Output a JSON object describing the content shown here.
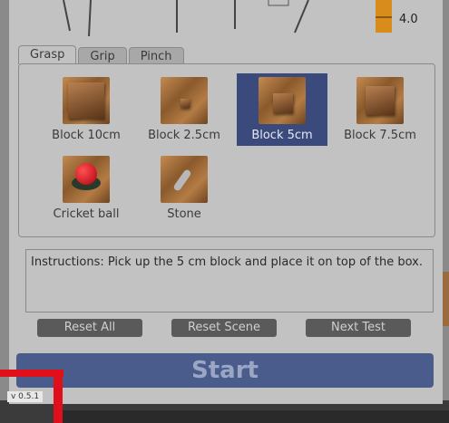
{
  "slider": {
    "value_text": "4.0"
  },
  "tabs": [
    {
      "label": "Grasp",
      "active": true
    },
    {
      "label": "Grip",
      "active": false
    },
    {
      "label": "Pinch",
      "active": false
    }
  ],
  "objects": [
    {
      "label": "Block 10cm",
      "icon": "block-10cm-thumbnail",
      "selected": false
    },
    {
      "label": "Block 2.5cm",
      "icon": "block-2-5cm-thumbnail",
      "selected": false
    },
    {
      "label": "Block 5cm",
      "icon": "block-5cm-thumbnail",
      "selected": true
    },
    {
      "label": "Block 7.5cm",
      "icon": "block-7-5cm-thumbnail",
      "selected": false
    },
    {
      "label": "Cricket ball",
      "icon": "cricket-ball-thumbnail",
      "selected": false
    },
    {
      "label": "Stone",
      "icon": "stone-thumbnail",
      "selected": false
    }
  ],
  "instructions": "Instructions: Pick up the 5 cm block and place it on top of the box.",
  "buttons": {
    "reset_all": "Reset All",
    "reset_scene": "Reset Scene",
    "next_test": "Next Test",
    "start": "Start"
  },
  "version": "v 0.5.1",
  "colors": {
    "selected": "#3a4a7c",
    "start": "#4a5c8c",
    "slider": "#d88c1c",
    "marker": "#e0101a"
  }
}
